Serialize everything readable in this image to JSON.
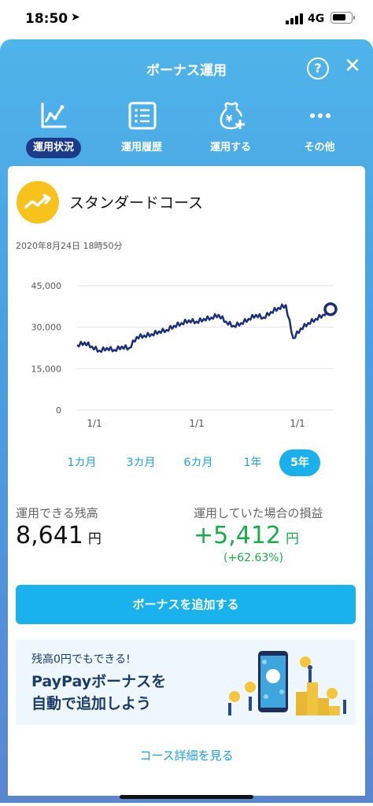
{
  "status_bar": {
    "time": "18:50",
    "network": "4G"
  },
  "header": {
    "title": "ボーナス運用",
    "help_label": "?",
    "close_label": "✕"
  },
  "nav": [
    {
      "label": "運用状況",
      "icon": "line-chart-icon",
      "active": true
    },
    {
      "label": "運用履歴",
      "icon": "list-icon",
      "active": false
    },
    {
      "label": "運用する",
      "icon": "money-bag-plus-icon",
      "active": false
    },
    {
      "label": "その他",
      "icon": "more-dots-icon",
      "active": false
    }
  ],
  "course": {
    "name": "スタンダードコース",
    "icon": "trend-up-icon"
  },
  "timestamp": "2020年8月24日 18時50分",
  "chart_data": {
    "type": "line",
    "y_ticks": [
      "45,000",
      "30,000",
      "15,000",
      "0"
    ],
    "ylim": [
      0,
      45000
    ],
    "x_ticks": [
      "1/1",
      "1/1",
      "1/1"
    ],
    "x": [
      "2015-08",
      "2015-10",
      "2015-12",
      "2016-02",
      "2016-04",
      "2016-06",
      "2016-08",
      "2016-10",
      "2016-12",
      "2017-02",
      "2017-04",
      "2017-06",
      "2017-08",
      "2017-10",
      "2017-12",
      "2018-02",
      "2018-04",
      "2018-06",
      "2018-08",
      "2018-10",
      "2018-12",
      "2019-01",
      "2019-03",
      "2019-05",
      "2019-07",
      "2019-09",
      "2019-11",
      "2020-01",
      "2020-02",
      "2020-03",
      "2020-04",
      "2020-05",
      "2020-06",
      "2020-07",
      "2020-08"
    ],
    "series": [
      {
        "values": [
          23500,
          24500,
          23000,
          21500,
          22500,
          21800,
          23000,
          22500,
          26500,
          27000,
          27500,
          28500,
          29000,
          30500,
          31500,
          32500,
          32000,
          33000,
          33500,
          34500,
          32000,
          30500,
          31500,
          33000,
          34500,
          33500,
          35500,
          37000,
          38000,
          26000,
          29500,
          31500,
          33000,
          34500,
          36500
        ]
      }
    ],
    "grid": true,
    "line_color": "#1b2f7a"
  },
  "periods": [
    {
      "label": "1カ月",
      "active": false
    },
    {
      "label": "3カ月",
      "active": false
    },
    {
      "label": "6カ月",
      "active": false
    },
    {
      "label": "1年",
      "active": false
    },
    {
      "label": "5年",
      "active": true
    }
  ],
  "balance": {
    "label": "運用できる残高",
    "value": "8,641",
    "unit": "円"
  },
  "profit": {
    "label": "運用していた場合の損益",
    "value": "+5,412",
    "unit": "円",
    "percent": "(+62.63%)"
  },
  "add_button": "ボーナスを追加する",
  "promo": {
    "small": "残高0円でもできる!",
    "line1": "PayPayボーナスを",
    "line2": "自動で追加しよう"
  },
  "detail_link": "コース詳細を見る",
  "colors": {
    "accent": "#1ab2ec",
    "nav_active": "#1b3b8a",
    "profit": "#1aab4b"
  }
}
